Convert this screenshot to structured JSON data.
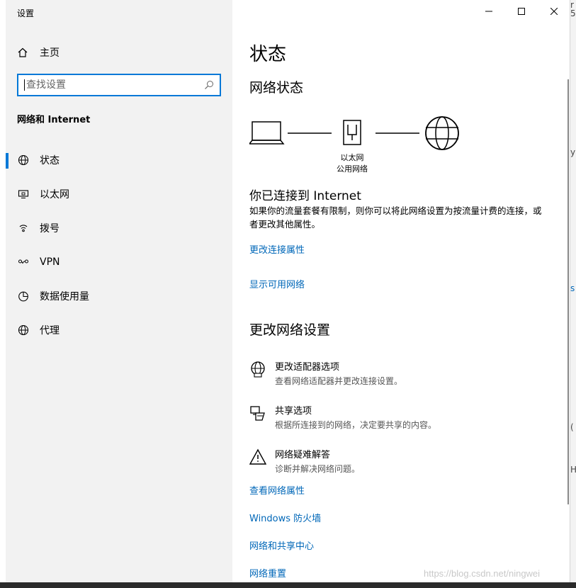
{
  "window": {
    "title": "设置"
  },
  "sidebar": {
    "home_label": "主页",
    "search_placeholder": "查找设置",
    "section_title": "网络和 Internet",
    "items": [
      {
        "label": "状态",
        "icon": "globe-icon",
        "active": true
      },
      {
        "label": "以太网",
        "icon": "ethernet-icon",
        "active": false
      },
      {
        "label": "拨号",
        "icon": "dialup-icon",
        "active": false
      },
      {
        "label": "VPN",
        "icon": "vpn-icon",
        "active": false
      },
      {
        "label": "数据使用量",
        "icon": "data-usage-icon",
        "active": false
      },
      {
        "label": "代理",
        "icon": "proxy-globe-icon",
        "active": false
      }
    ]
  },
  "main": {
    "page_title": "状态",
    "network_status_heading": "网络状态",
    "diagram": {
      "adapter_name": "以太网",
      "network_type": "公用网络"
    },
    "connected_title": "你已连接到 Internet",
    "connected_desc": "如果你的流量套餐有限制，则你可以将此网络设置为按流量计费的连接，或者更改其他属性。",
    "links_top": {
      "change_props": "更改连接属性",
      "show_networks": "显示可用网络"
    },
    "change_settings_heading": "更改网络设置",
    "settings": [
      {
        "title": "更改适配器选项",
        "desc": "查看网络适配器并更改连接设置。",
        "icon": "adapter-globe-icon"
      },
      {
        "title": "共享选项",
        "desc": "根据所连接到的网络，决定要共享的内容。",
        "icon": "sharing-icon"
      },
      {
        "title": "网络疑难解答",
        "desc": "诊断并解决网络问题。",
        "icon": "warning-icon"
      }
    ],
    "links_bottom": {
      "view_props": "查看网络属性",
      "firewall": "Windows 防火墙",
      "sharing_center": "网络和共享中心",
      "reset": "网络重置"
    }
  },
  "watermark": "https://blog.csdn.net/ningwei",
  "colors": {
    "accent": "#0078d7",
    "link": "#0067b8",
    "sidebar_bg": "#f2f2f2"
  }
}
